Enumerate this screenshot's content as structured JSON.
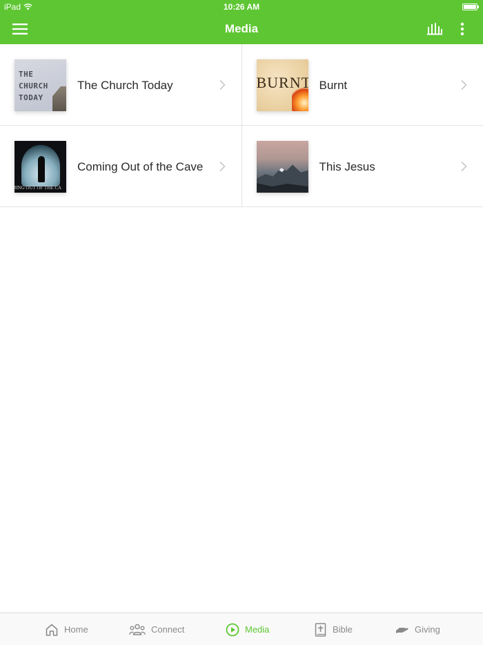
{
  "status_bar": {
    "carrier": "iPad",
    "time": "10:26 AM",
    "battery_icon": "battery-icon",
    "wifi_icon": "wifi-icon"
  },
  "app_bar": {
    "title": "Media",
    "menu_icon": "hamburger-menu-icon",
    "stats_icon": "bar-chart-icon",
    "more_icon": "vertical-ellipsis-icon"
  },
  "colors": {
    "accent": "#5ec633",
    "text": "#2a2a2a",
    "tab_inactive": "#8a8a8a",
    "divider": "#e3e3e3"
  },
  "media_items": [
    {
      "label": "The Church Today",
      "thumb_text": [
        "THE",
        "CHURCH",
        "TODAY"
      ]
    },
    {
      "label": "Burnt",
      "thumb_text": "BURNT"
    },
    {
      "label": "Coming Out of the Cave",
      "thumb_text": "MING OUT OF THE CA"
    },
    {
      "label": "This Jesus"
    }
  ],
  "tabs": [
    {
      "label": "Home",
      "icon": "home-icon",
      "active": false
    },
    {
      "label": "Connect",
      "icon": "people-icon",
      "active": false
    },
    {
      "label": "Media",
      "icon": "play-circle-icon",
      "active": true
    },
    {
      "label": "Bible",
      "icon": "bible-icon",
      "active": false
    },
    {
      "label": "Giving",
      "icon": "giving-hand-icon",
      "active": false
    }
  ]
}
